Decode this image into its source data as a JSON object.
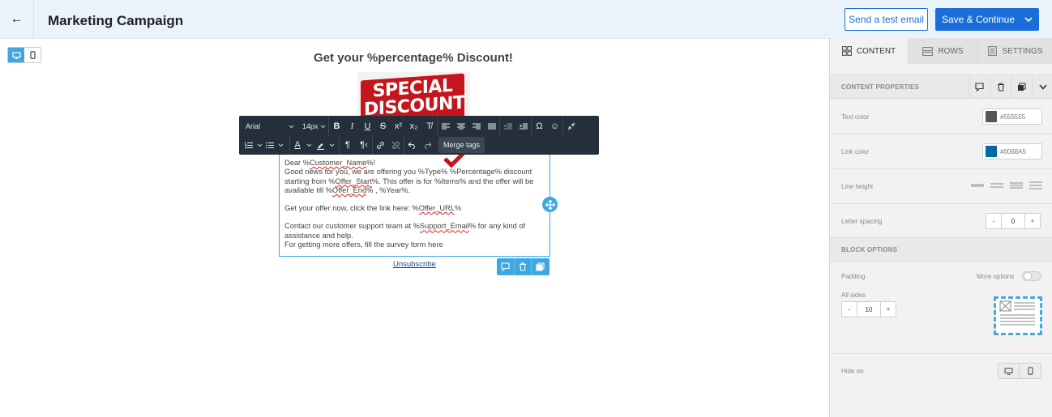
{
  "header": {
    "back_icon": "arrow-left-icon",
    "title": "Marketing Campaign",
    "test_email_label": "Send a test email",
    "save_label": "Save & Continue",
    "accent": "#1a6ed8"
  },
  "device_toggle": {
    "active": "desktop"
  },
  "email": {
    "headline": "Get your %percentage% Discount!",
    "hero_text_line1": "SPECIAL",
    "hero_text_line2": "DISCOUNT",
    "greeting_pre": "Dear %",
    "greeting_var": "Customer_Name",
    "greeting_post": "%!",
    "p1_a": "Good news for you, we are offering you %Type% %Percentage% discount starting from %",
    "p1_var1": "Offer_Start",
    "p1_b": "%. This offer is for %Items% and the offer will be available till %",
    "p1_var2": "Offer_End",
    "p1_c": "% , %Year%.",
    "p2_a": "Get your offer now, click the link here: %",
    "p2_var": "Offer_URL",
    "p2_b": "%",
    "p3_a": "Contact our customer support team at %",
    "p3_var": "Support_Email",
    "p3_b": "% for any kind of assistance and help.",
    "p4": "For getting more offers, fill the survey form here",
    "unsubscribe": "Unsubscribe"
  },
  "toolbar": {
    "font": "Arial",
    "size": "14px",
    "merge_tags": "Merge tags"
  },
  "sidebar": {
    "tabs": [
      {
        "label": "CONTENT",
        "icon": "grid-icon"
      },
      {
        "label": "ROWS",
        "icon": "rows-icon"
      },
      {
        "label": "SETTINGS",
        "icon": "settings-list-icon"
      }
    ],
    "content_properties": "CONTENT PROPERTIES",
    "text_color_label": "Text color",
    "text_color_value": "#555555",
    "link_color_label": "Link color",
    "link_color_value": "#0068A5",
    "line_height_label": "Line height",
    "letter_spacing_label": "Letter spacing",
    "letter_spacing_value": "0",
    "block_options": "BLOCK OPTIONS",
    "padding_label": "Padding",
    "more_options_label": "More options",
    "all_sides_label": "All sides",
    "padding_value": "10",
    "hide_on_label": "Hide on"
  }
}
